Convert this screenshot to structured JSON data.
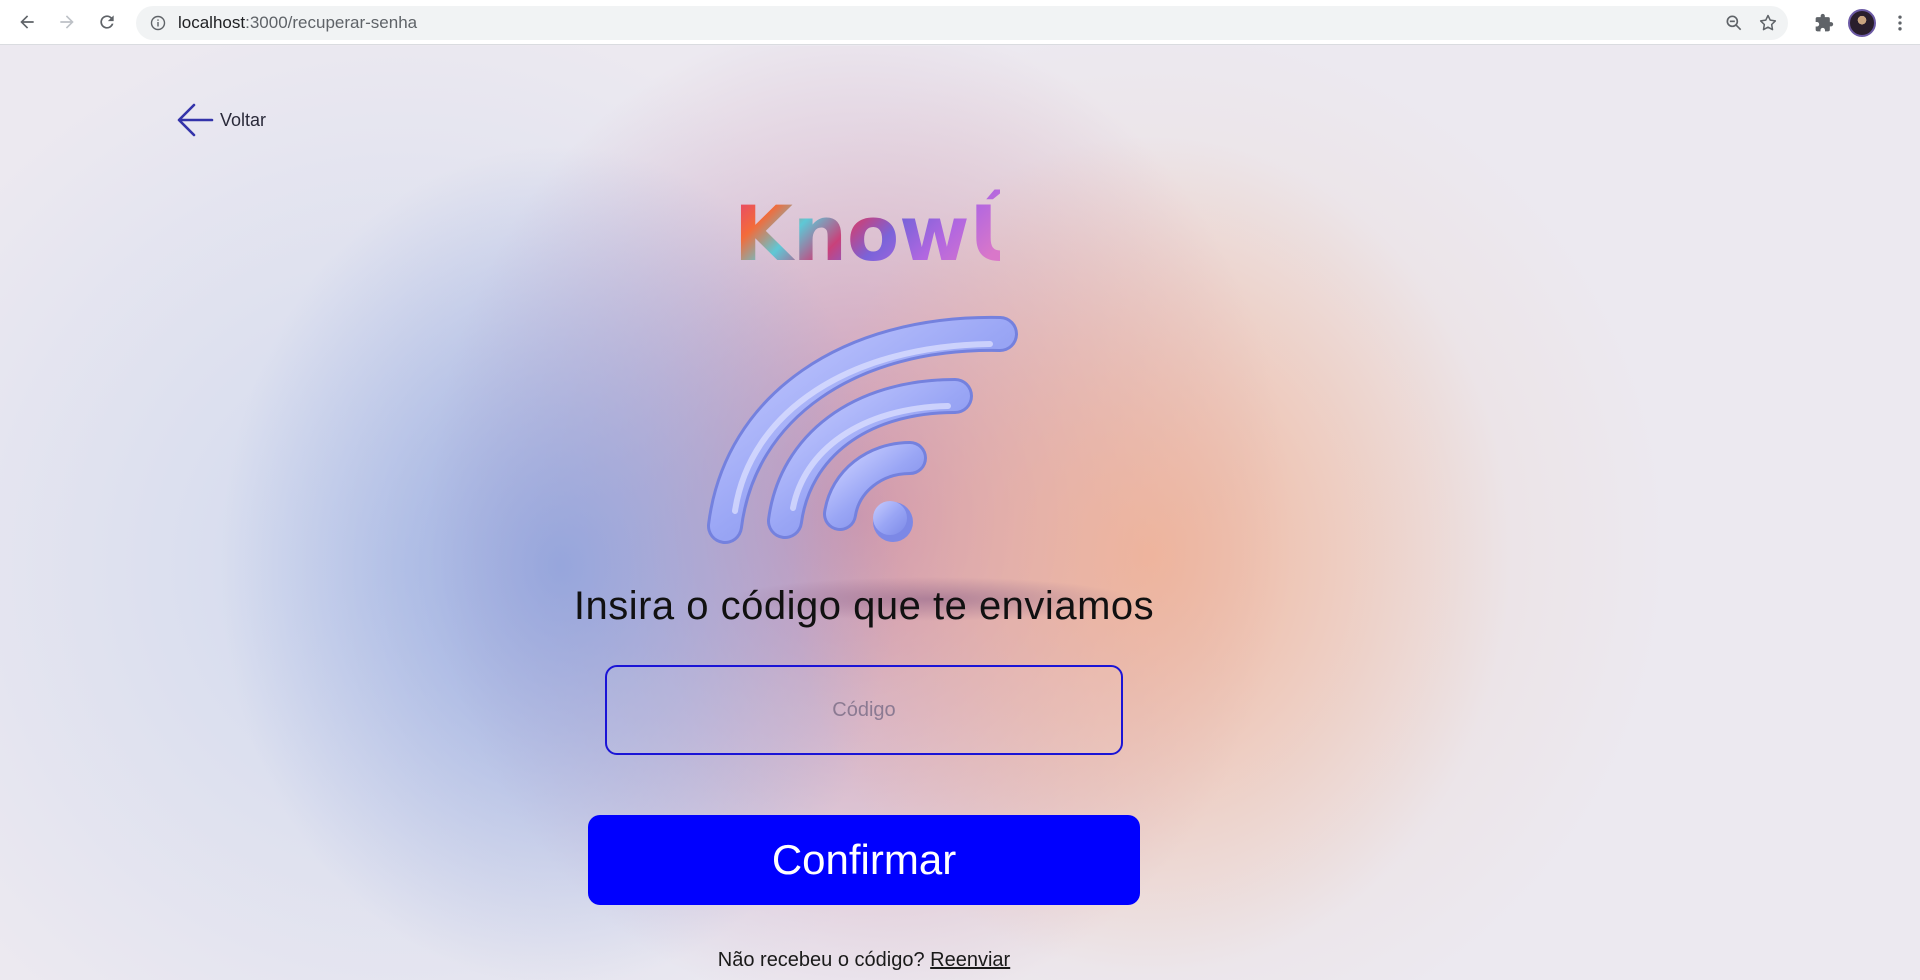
{
  "browser": {
    "url_host": "localhost",
    "url_path": ":3000/recuperar-senha"
  },
  "page": {
    "back_label": "Voltar",
    "logo_text": "KnowÛ",
    "heading": "Insira o código que te enviamos",
    "code_input": {
      "placeholder": "Código",
      "value": ""
    },
    "confirm_label": "Confirmar",
    "resend_prompt": "Não recebeu o código?",
    "resend_link": "Reenviar"
  },
  "colors": {
    "primary_button": "#0000ff",
    "input_border": "#1a14d6",
    "wifi_icon": "#9fa9f7"
  },
  "icons": [
    "back-arrow-icon",
    "forward-arrow-icon",
    "reload-icon",
    "info-icon",
    "zoom-out-icon",
    "star-icon",
    "extensions-icon",
    "menu-icon",
    "wifi-icon"
  ]
}
